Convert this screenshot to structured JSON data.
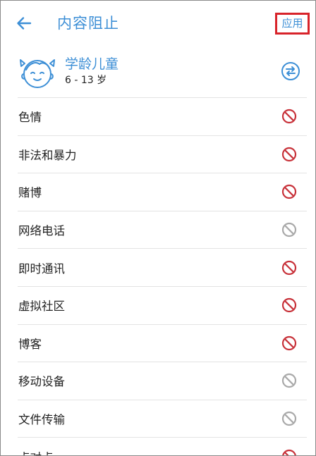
{
  "header": {
    "back_icon": "arrow-left-icon",
    "title": "内容阻止",
    "apply_label": "应用"
  },
  "profile": {
    "avatar_icon": "child-face-icon",
    "name": "学龄儿童",
    "age_range": "6 - 13 岁",
    "switch_icon": "swap-arrows-icon"
  },
  "categories": [
    {
      "label": "色情",
      "blocked": true
    },
    {
      "label": "非法和暴力",
      "blocked": true
    },
    {
      "label": "赌博",
      "blocked": true
    },
    {
      "label": "网络电话",
      "blocked": false
    },
    {
      "label": "即时通讯",
      "blocked": true
    },
    {
      "label": "虚拟社区",
      "blocked": true
    },
    {
      "label": "博客",
      "blocked": true
    },
    {
      "label": "移动设备",
      "blocked": false
    },
    {
      "label": "文件传输",
      "blocked": false
    },
    {
      "label": "点对点",
      "blocked": true
    }
  ],
  "colors": {
    "accent": "#3d8fd6",
    "blocked": "#c8323a",
    "allowed": "#a9a9a9",
    "highlight_border": "#d8232a"
  }
}
